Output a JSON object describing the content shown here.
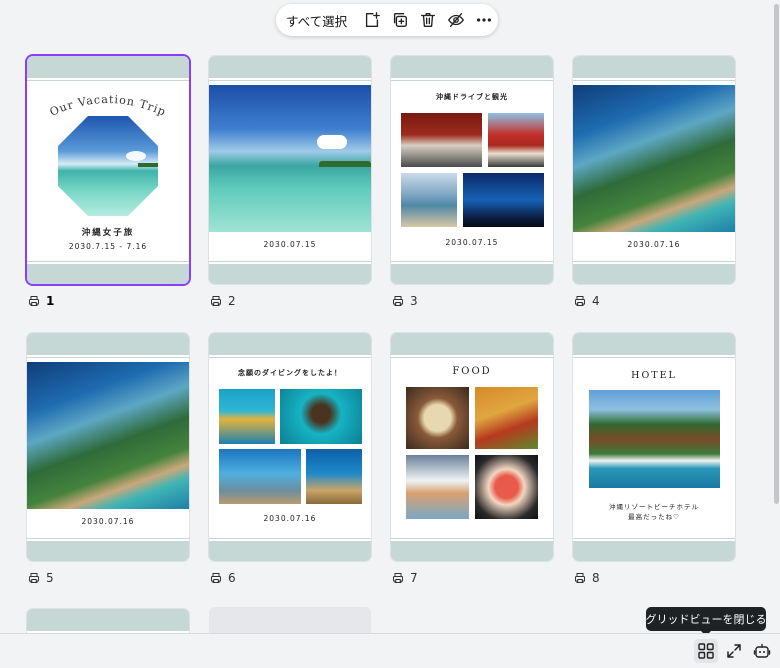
{
  "toolbar": {
    "select_all_label": "すべて選択",
    "icons": [
      "add-page-icon",
      "duplicate-icon",
      "trash-icon",
      "hide-icon",
      "more-icon"
    ]
  },
  "pages": [
    {
      "number": "1",
      "title": "Our Vacation Trip",
      "caption": "沖縄女子旅",
      "date": "2030.7.15 - 7.16",
      "selected": true
    },
    {
      "number": "2",
      "date": "2030.07.15"
    },
    {
      "number": "3",
      "title": "沖縄ドライブと観光",
      "date": "2030.07.15"
    },
    {
      "number": "4",
      "date": "2030.07.16"
    },
    {
      "number": "5",
      "date": "2030.07.16"
    },
    {
      "number": "6",
      "title": "念願のダイビングをしたよ！",
      "date": "2030.07.16"
    },
    {
      "number": "7",
      "title": "FOOD"
    },
    {
      "number": "8",
      "title": "HOTEL",
      "caption_line1": "沖縄リゾートビーチホテル",
      "caption_line2": "最高だったね♡"
    }
  ],
  "tooltip": "グリッドビューを閉じる",
  "bottom_bar": {
    "icons": [
      "grid-view-icon",
      "fullscreen-icon",
      "assistant-icon"
    ]
  },
  "colors": {
    "accent": "#8b3dff",
    "band": "#c5d8d5",
    "tooltip_bg": "#1f2225"
  }
}
